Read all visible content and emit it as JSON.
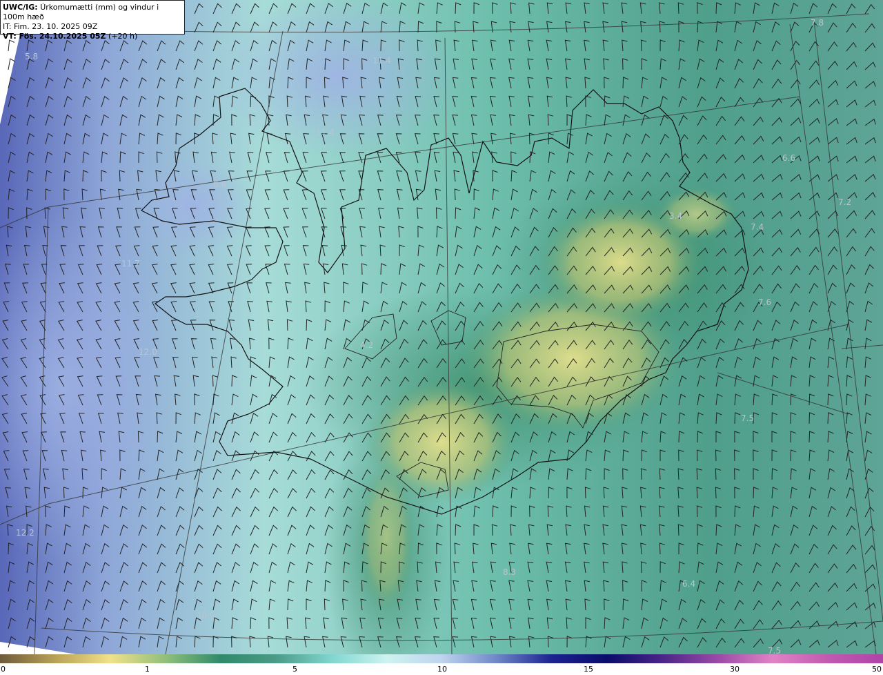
{
  "header": {
    "model_code": "UWC/IG:",
    "description": "Úrkomumætti (mm) og vindur i 100m hæð",
    "initial_time": "IT: Fim. 23. 10. 2025 09Z",
    "valid_prefix": "VT: Fös. 24.10.2025 05Z",
    "valid_lead": "(+20 h)"
  },
  "map_values": [
    "7.8",
    "5.8",
    "11.4",
    "11.4",
    "6.6",
    "6.6",
    "7.2",
    "7.4",
    "3.4",
    "11.7",
    "7.6",
    "12.0",
    "4.2",
    "7.5",
    "12.2",
    "8.3",
    "6.4",
    "10.9",
    "7.5"
  ],
  "colorbar": {
    "ticks": [
      "0",
      "1",
      "5",
      "10",
      "15",
      "30",
      "50"
    ],
    "stops": [
      "#6f5a3c",
      "#b8a257",
      "#f1e18a",
      "#8fbf7a",
      "#2f8a6a",
      "#4a9b88",
      "#7fd6cf",
      "#cdf3f0",
      "#bfd4ee",
      "#6e86c6",
      "#1c2290",
      "#0a0d6a",
      "#4a2488",
      "#9a4aa6",
      "#e083c6",
      "#c05ab0",
      "#b043a8"
    ],
    "colors": {
      "land_high": "#d8d98a",
      "sea": "#7ec7bb",
      "west_blue": "#8b9fd3"
    }
  }
}
